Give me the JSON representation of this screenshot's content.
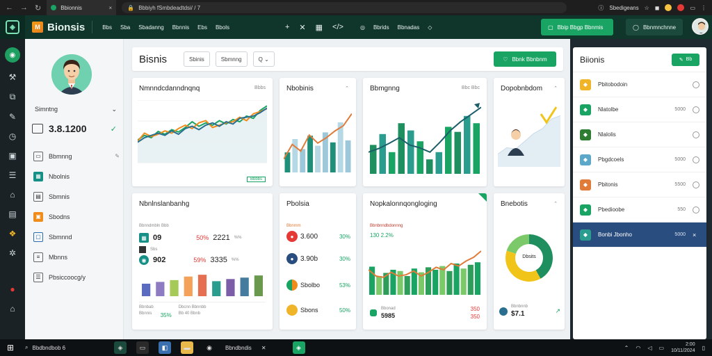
{
  "browser": {
    "tab_title": "Bbionnis",
    "url": "Bbbiyh fSmbdeadtdsi/ / 7",
    "profile_label": "Sbedigeans"
  },
  "header": {
    "brand": "Bionsis",
    "nav": [
      "Bbs",
      "Sba",
      "Sbadanng",
      "Bbnnis",
      "Ebs",
      "Bbols"
    ],
    "links": [
      "Bbrids",
      "Bbnadas"
    ],
    "primary_button": "Bbip Bbgp Bbnmis",
    "secondary_button": "Bbnmnchnne"
  },
  "sidebar": {
    "profile_name": "Simntng",
    "profile_value": "3.8.1200",
    "items": [
      {
        "label": "Bbmnng",
        "icon": "monitor-icon"
      },
      {
        "label": "Nbolnis",
        "icon": "grid-icon"
      },
      {
        "label": "Sbmnis",
        "icon": "calendar-icon"
      },
      {
        "label": "Sbodns",
        "icon": "shop-icon"
      },
      {
        "label": "Sbmnnd",
        "icon": "browser-icon"
      },
      {
        "label": "Mbnns",
        "icon": "document-icon"
      },
      {
        "label": "Pbsiccoocg/y",
        "icon": "list-icon"
      }
    ]
  },
  "toolbar": {
    "title": "Bisnis",
    "chip1": "Sbinis",
    "chip2": "Sbmnng",
    "chip3": "Q",
    "action": "Bbnk Bbnbnm"
  },
  "cards": {
    "c1": {
      "title": "Nmnndcdanndnqnq",
      "controls": "Bbbs",
      "legend": "Bbbbs"
    },
    "c2": {
      "title": "Nbobinis"
    },
    "c3": {
      "title": "Bbmgnng",
      "controls": "Bbc Bbc"
    },
    "c4": {
      "title": "Dopobnbdom"
    },
    "c5": {
      "title": "Nbnlnslanbanhg",
      "subtitle": "Bbnndmbln Bbb",
      "rows": [
        {
          "label": "09",
          "pct": "50%",
          "value": "2221",
          "pct2": "%%"
        },
        {
          "label": "Sbs",
          "pct": "",
          "value": "",
          "pct2": ""
        },
        {
          "label": "902",
          "pct": "59%",
          "value": "3335",
          "pct2": "%%"
        }
      ],
      "footer_left": "Bbnbab",
      "footer_left2": "Bbnnis",
      "footer_pct": "35%",
      "footer_right": "Dbcnn Bbnnbb",
      "footer_right_val": "Bb 40 Bbnb"
    },
    "c6": {
      "title": "Pbolsia",
      "subtitle": "Bbnmm",
      "rows": [
        {
          "label": "3.600",
          "pct": "30%"
        },
        {
          "label": "3.90b",
          "pct": "30%"
        },
        {
          "label": "Sbolbo",
          "pct": "53%"
        },
        {
          "label": "Sbons",
          "pct": "50%"
        }
      ]
    },
    "c7": {
      "title": "Nopkalonnqongloging",
      "subtitle": "Bbnbnndbdonnng",
      "kpi": "130 2.2%",
      "footer": "Bbonad",
      "footer_val": "5985",
      "footer_right": "350",
      "footer_right2": "350"
    },
    "c8": {
      "title": "Bnebotis",
      "center": "Dbsits",
      "footer": "Bbnbnnb",
      "footer_val": "$7.1"
    }
  },
  "right_panel": {
    "title": "Biionis",
    "button": "Bb",
    "items": [
      {
        "label": "Pbitobodoin",
        "value": "",
        "color": "#f0b429"
      },
      {
        "label": "Nlatolbe",
        "value": "5000",
        "color": "#19a463"
      },
      {
        "label": "Nlalolis",
        "value": "",
        "color": "#2e7d32"
      },
      {
        "label": "Pbgdcoels",
        "value": "5000",
        "color": "#5da7c9"
      },
      {
        "label": "Pbitonis",
        "value": "5500",
        "color": "#e07b39"
      },
      {
        "label": "Pbedioobe",
        "value": "550",
        "color": "#19a463"
      },
      {
        "label": "Bonbi Jbonho",
        "value": "5000",
        "color": "#2a9d8f",
        "selected": true
      }
    ]
  },
  "taskbar": {
    "search": "Bbdbndbob 6",
    "app_label": "Bbndbndis",
    "time": "2:00",
    "date": "10/11/2024"
  },
  "colors": {
    "accent": "#19a463",
    "header_bg": "#10352b",
    "selected": "#2a4d7f"
  },
  "chart_data": [
    {
      "type": "line",
      "title": "Nmnndcdanndnqnq",
      "x": [
        1,
        2,
        3,
        4,
        5,
        6,
        7,
        8,
        9,
        10,
        11,
        12,
        13,
        14,
        15,
        16,
        17,
        18,
        19,
        20
      ],
      "series": [
        {
          "values": [
            40,
            48,
            44,
            55,
            50,
            58,
            54,
            62,
            72,
            64,
            70,
            66,
            74,
            68,
            76,
            72,
            82,
            78,
            92,
            100
          ]
        },
        {
          "values": [
            38,
            52,
            46,
            50,
            56,
            52,
            60,
            66,
            60,
            70,
            74,
            62,
            66,
            70,
            72,
            80,
            74,
            86,
            90,
            95
          ]
        },
        {
          "values": [
            36,
            44,
            48,
            52,
            48,
            56,
            50,
            60,
            64,
            58,
            66,
            70,
            64,
            72,
            68,
            78,
            80,
            82,
            88,
            96
          ]
        }
      ],
      "ylim": [
        0,
        110
      ]
    },
    {
      "type": "bar",
      "title": "Nbobinis",
      "values": [
        30,
        50,
        35,
        55,
        40,
        60,
        45,
        75,
        48
      ],
      "line": [
        20,
        42,
        32,
        56,
        44,
        52,
        62,
        70,
        88
      ],
      "ylim": [
        0,
        100
      ]
    },
    {
      "type": "bar",
      "title": "Bbmgnng",
      "values": [
        40,
        55,
        30,
        70,
        60,
        45,
        20,
        30,
        65,
        58,
        80,
        70
      ],
      "line": [
        30,
        35,
        42,
        50,
        40,
        36,
        30,
        44,
        60,
        72,
        82,
        92
      ],
      "ylim": [
        0,
        100
      ]
    },
    {
      "type": "area",
      "title": "Dopobnbdom",
      "values": [
        20,
        30,
        28,
        40,
        52,
        60,
        75,
        80
      ],
      "ylim": [
        0,
        100
      ]
    },
    {
      "type": "bar",
      "title": "Nbnlnslanbanhg",
      "values": [
        35,
        40,
        45,
        55,
        60,
        42,
        48,
        52,
        58
      ],
      "ylim": [
        0,
        70
      ]
    },
    {
      "type": "bar",
      "title": "Nopkalonnqongloging",
      "values": [
        45,
        30,
        35,
        40,
        38,
        30,
        42,
        36,
        44,
        40,
        46,
        38,
        50,
        42,
        48,
        52
      ],
      "line": [
        40,
        30,
        28,
        36,
        30,
        32,
        38,
        30,
        36,
        44,
        40,
        50,
        46,
        54,
        60,
        70
      ],
      "ylim": [
        0,
        80
      ]
    },
    {
      "type": "pie",
      "title": "Bnebotis",
      "values": [
        42,
        38,
        20
      ],
      "colors": [
        "#1f8f5f",
        "#f0c419",
        "#7cc96a"
      ]
    }
  ]
}
